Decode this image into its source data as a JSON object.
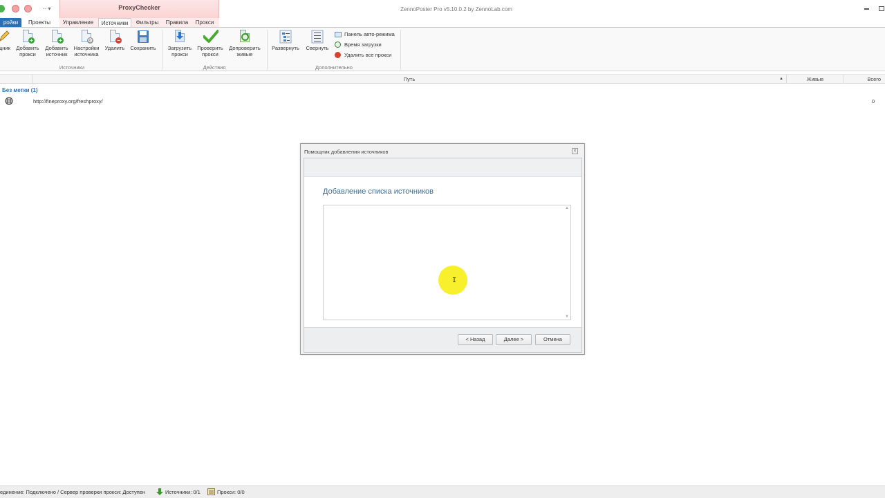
{
  "app": {
    "title": "ZennoPoster Pro v5.10.0.2 by ZennoLab.com",
    "context_title": "ProxyChecker"
  },
  "tabs": [
    {
      "label": "ройки"
    },
    {
      "label": "Проекты"
    },
    {
      "label": "Управление"
    },
    {
      "label": "Источники"
    },
    {
      "label": "Фильтры"
    },
    {
      "label": "Правила"
    },
    {
      "label": "Прокси"
    }
  ],
  "ribbon": {
    "sources_group": {
      "label": "Источники",
      "buttons": [
        {
          "label": "щник"
        },
        {
          "label": "Добавить\nпрокси"
        },
        {
          "label": "Добавить\nисточник"
        },
        {
          "label": "Настройки\nисточника"
        },
        {
          "label": "Удалить"
        },
        {
          "label": "Сохранить"
        }
      ]
    },
    "actions_group": {
      "label": "Действия",
      "buttons": [
        {
          "label": "Загрузить\nпрокси"
        },
        {
          "label": "Проверить\nпрокси"
        },
        {
          "label": "Допроверить\nживые"
        }
      ]
    },
    "extra_group": {
      "label": "Дополнительно",
      "buttons": [
        {
          "label": "Развернуть"
        },
        {
          "label": "Свернуть"
        }
      ],
      "small_buttons": [
        {
          "label": "Панель авто-режима"
        },
        {
          "label": "Время загрузки"
        },
        {
          "label": "Удалить все прокси"
        }
      ]
    }
  },
  "grid": {
    "columns": [
      "Путь",
      "Живые",
      "Всего"
    ],
    "group_label": "Без метки (1)",
    "rows": [
      {
        "path": "http://fineproxy.org/freshproxy/",
        "live": "",
        "total": "0"
      }
    ]
  },
  "dialog": {
    "title": "Помощник добавления источников",
    "heading": "Добавление списка источников",
    "textarea_value": "",
    "back_label": "< Назад",
    "next_label": "Далее >",
    "cancel_label": "Отмена"
  },
  "statusbar": {
    "connection": "единение: Подключено / Сервер проверки прокси: Доступен",
    "sources": "Источники: 0/1",
    "proxies": "Прокси: 0/0"
  },
  "colors": {
    "accent": "#2b6fb6",
    "context_tab": "#fbd3d3",
    "heading": "#3c6f9c",
    "cursor_highlight": "#f7ef1a"
  }
}
